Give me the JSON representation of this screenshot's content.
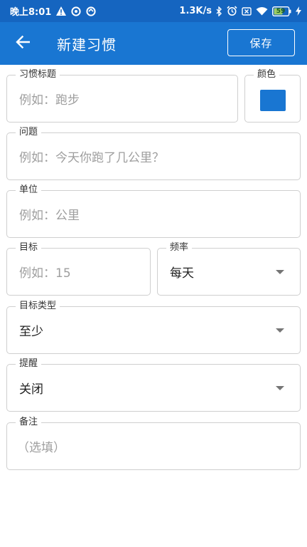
{
  "status_bar": {
    "time": "晚上8:01",
    "speed": "1.3K/s",
    "battery": "59",
    "icons": [
      "warning-icon",
      "sync-icon",
      "sync-icon",
      "bluetooth-icon",
      "alarm-icon",
      "sim-icon",
      "wifi-icon",
      "battery-icon",
      "charging-icon"
    ]
  },
  "app_bar": {
    "title": "新建习惯",
    "save_label": "保存",
    "background": "#1976d2"
  },
  "form": {
    "habit_title": {
      "label": "习惯标题",
      "placeholder": "例如：跑步"
    },
    "color": {
      "label": "颜色",
      "value": "#1976d2"
    },
    "question": {
      "label": "问题",
      "placeholder": "例如：今天你跑了几公里？"
    },
    "unit": {
      "label": "单位",
      "placeholder": "例如：公里"
    },
    "target": {
      "label": "目标",
      "placeholder": "例如：15"
    },
    "frequency": {
      "label": "频率",
      "value": "每天"
    },
    "target_type": {
      "label": "目标类型",
      "value": "至少"
    },
    "reminder": {
      "label": "提醒",
      "value": "关闭"
    },
    "notes": {
      "label": "备注",
      "placeholder": "（选填）"
    }
  }
}
